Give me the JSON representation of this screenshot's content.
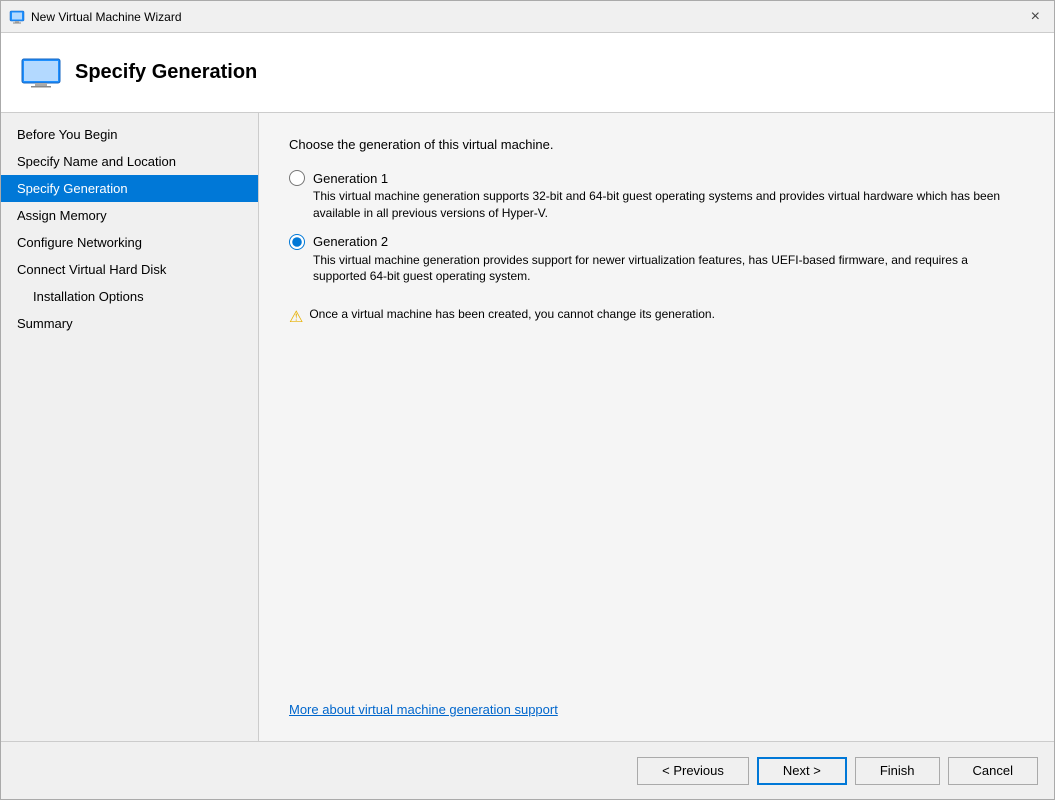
{
  "window": {
    "title": "New Virtual Machine Wizard",
    "close_label": "×"
  },
  "header": {
    "title": "Specify Generation"
  },
  "sidebar": {
    "items": [
      {
        "id": "before-you-begin",
        "label": "Before You Begin",
        "active": false,
        "indented": false
      },
      {
        "id": "specify-name",
        "label": "Specify Name and Location",
        "active": false,
        "indented": false
      },
      {
        "id": "specify-generation",
        "label": "Specify Generation",
        "active": true,
        "indented": false
      },
      {
        "id": "assign-memory",
        "label": "Assign Memory",
        "active": false,
        "indented": false
      },
      {
        "id": "configure-networking",
        "label": "Configure Networking",
        "active": false,
        "indented": false
      },
      {
        "id": "connect-vhd",
        "label": "Connect Virtual Hard Disk",
        "active": false,
        "indented": false
      },
      {
        "id": "installation-options",
        "label": "Installation Options",
        "active": false,
        "indented": true
      },
      {
        "id": "summary",
        "label": "Summary",
        "active": false,
        "indented": false
      }
    ]
  },
  "main": {
    "intro": "Choose the generation of this virtual machine.",
    "generation1": {
      "label": "Generation 1",
      "description": "This virtual machine generation supports 32-bit and 64-bit guest operating systems and provides virtual hardware which has been available in all previous versions of Hyper-V."
    },
    "generation2": {
      "label": "Generation 2",
      "description": "This virtual machine generation provides support for newer virtualization features, has UEFI-based firmware, and requires a supported 64-bit guest operating system."
    },
    "warning": "Once a virtual machine has been created, you cannot change its generation.",
    "link": "More about virtual machine generation support"
  },
  "footer": {
    "previous_label": "< Previous",
    "next_label": "Next >",
    "finish_label": "Finish",
    "cancel_label": "Cancel"
  }
}
